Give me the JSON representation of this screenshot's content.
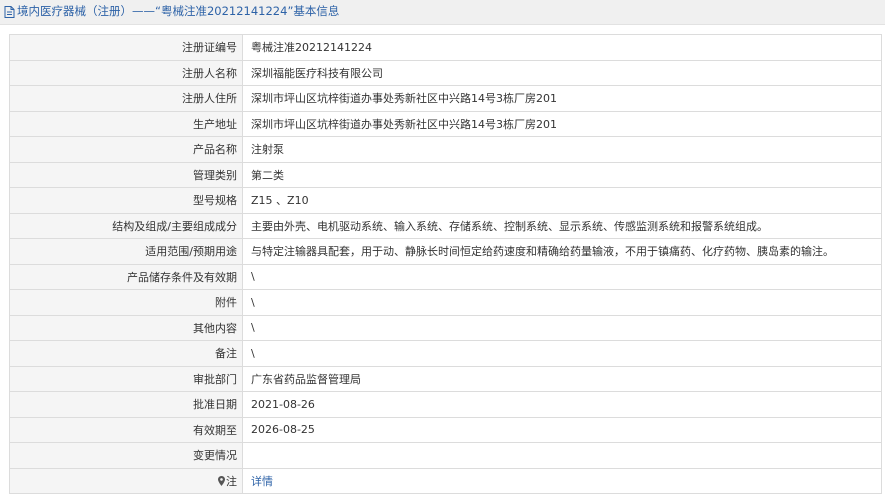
{
  "header": {
    "title": "境内医疗器械（注册）——“粤械注准20212141224”基本信息",
    "icon": "document-icon"
  },
  "fields": [
    {
      "label": "注册证编号",
      "value": "粤械注准20212141224"
    },
    {
      "label": "注册人名称",
      "value": "深圳福能医疗科技有限公司"
    },
    {
      "label": "注册人住所",
      "value": "深圳市坪山区坑梓街道办事处秀新社区中兴路14号3栋厂房201"
    },
    {
      "label": "生产地址",
      "value": "深圳市坪山区坑梓街道办事处秀新社区中兴路14号3栋厂房201"
    },
    {
      "label": "产品名称",
      "value": "注射泵"
    },
    {
      "label": "管理类别",
      "value": "第二类"
    },
    {
      "label": "型号规格",
      "value": "Z15 、Z10"
    },
    {
      "label": "结构及组成/主要组成成分",
      "value": "主要由外壳、电机驱动系统、输入系统、存储系统、控制系统、显示系统、传感监测系统和报警系统组成。"
    },
    {
      "label": "适用范围/预期用途",
      "value": "与特定注输器具配套，用于动、静脉长时间恒定给药速度和精确给药量输液，不用于镇痛药、化疗药物、胰岛素的输注。"
    },
    {
      "label": "产品储存条件及有效期",
      "value": "\\"
    },
    {
      "label": "附件",
      "value": "\\"
    },
    {
      "label": "其他内容",
      "value": "\\"
    },
    {
      "label": "备注",
      "value": "\\"
    },
    {
      "label": "审批部门",
      "value": "广东省药品监督管理局"
    },
    {
      "label": "批准日期",
      "value": "2021-08-26"
    },
    {
      "label": "有效期至",
      "value": "2026-08-25"
    },
    {
      "label": "变更情况",
      "value": ""
    }
  ],
  "note": {
    "label": "注",
    "icon": "location-pin-icon",
    "link_text": "详情"
  },
  "colors": {
    "title": "#2d62a7",
    "link": "#2d62a7",
    "label_bg": "#f5f5f5",
    "border": "#dcdcdc",
    "header_bg": "#f0f0f0"
  }
}
